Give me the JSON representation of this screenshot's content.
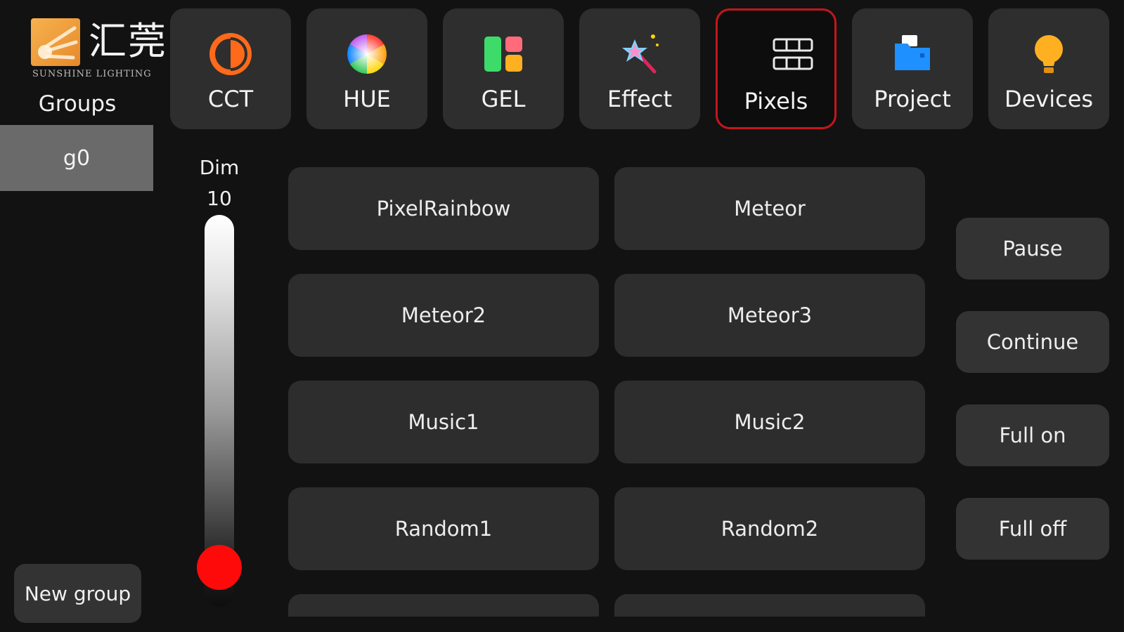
{
  "brand": {
    "name_cn": "汇莞",
    "name_en": "SUNSHINE LIGHTING",
    "logo_color": "#f0a03c"
  },
  "sidebar": {
    "title": "Groups",
    "groups": [
      {
        "label": "g0",
        "selected": true
      }
    ],
    "new_group_label": "New group"
  },
  "tabs": [
    {
      "label": "CCT",
      "icon": "half-circle-icon",
      "active": false
    },
    {
      "label": "HUE",
      "icon": "color-wheel-icon",
      "active": false
    },
    {
      "label": "GEL",
      "icon": "gel-swatches-icon",
      "active": false
    },
    {
      "label": "Effect",
      "icon": "magic-wand-icon",
      "active": false
    },
    {
      "label": "Pixels",
      "icon": "pixels-grid-icon",
      "active": true
    },
    {
      "label": "Project",
      "icon": "folder-icon",
      "active": false
    },
    {
      "label": "Devices",
      "icon": "lightbulb-icon",
      "active": false
    }
  ],
  "dimmer": {
    "label": "Dim",
    "value": "10",
    "level": 0.1,
    "knob_color": "#ff0a0a"
  },
  "effects": [
    "PixelRainbow",
    "Meteor",
    "Meteor2",
    "Meteor3",
    "Music1",
    "Music2",
    "Random1",
    "Random2"
  ],
  "controls": {
    "pause": "Pause",
    "continue": "Continue",
    "full_on": "Full on",
    "full_off": "Full off"
  },
  "colors": {
    "active_tab_border": "#c4161c",
    "button_bg": "#2d2d2d",
    "background": "#121212"
  }
}
